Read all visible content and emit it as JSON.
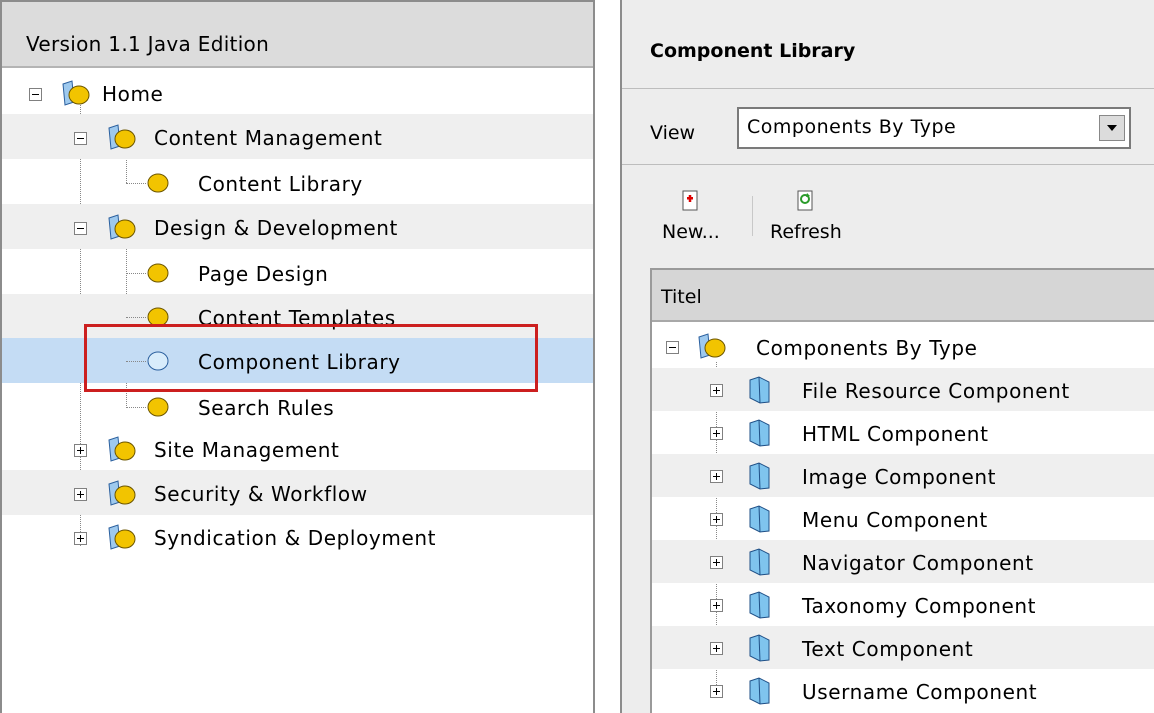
{
  "left_panel": {
    "header": "Version 1.1 Java Edition",
    "tree": [
      {
        "label": "Home",
        "expander": "minus",
        "icon": "folder-icon"
      },
      {
        "label": "Content Management",
        "expander": "minus",
        "icon": "folder-icon"
      },
      {
        "label": "Content Library",
        "expander": "",
        "icon": "node-icon"
      },
      {
        "label": "Design & Development",
        "expander": "minus",
        "icon": "folder-icon"
      },
      {
        "label": "Page Design",
        "expander": "",
        "icon": "node-icon"
      },
      {
        "label": "Content Templates",
        "expander": "",
        "icon": "node-icon"
      },
      {
        "label": "Component Library",
        "expander": "",
        "icon": "node-icon",
        "selected": true
      },
      {
        "label": "Search Rules",
        "expander": "",
        "icon": "node-icon"
      },
      {
        "label": "Site Management",
        "expander": "plus",
        "icon": "folder-icon"
      },
      {
        "label": "Security & Workflow",
        "expander": "plus",
        "icon": "folder-icon"
      },
      {
        "label": "Syndication & Deployment",
        "expander": "plus",
        "icon": "folder-icon"
      }
    ]
  },
  "right_panel": {
    "title": "Component Library",
    "view_label": "View",
    "view_select": "Components By Type",
    "toolbar": {
      "new_label": "New...",
      "refresh_label": "Refresh"
    },
    "grid": {
      "column_header": "Titel",
      "root": "Components By Type",
      "items": [
        "File Resource Component",
        "HTML Component",
        "Image Component",
        "Menu Component",
        "Navigator Component",
        "Taxonomy Component",
        "Text Component",
        "Username Component"
      ]
    }
  },
  "colors": {
    "selection": "#c4dcf4",
    "highlight_box": "#cc1f1f",
    "folder_yellow": "#f2c400",
    "component_blue": "#7fc4ee"
  }
}
